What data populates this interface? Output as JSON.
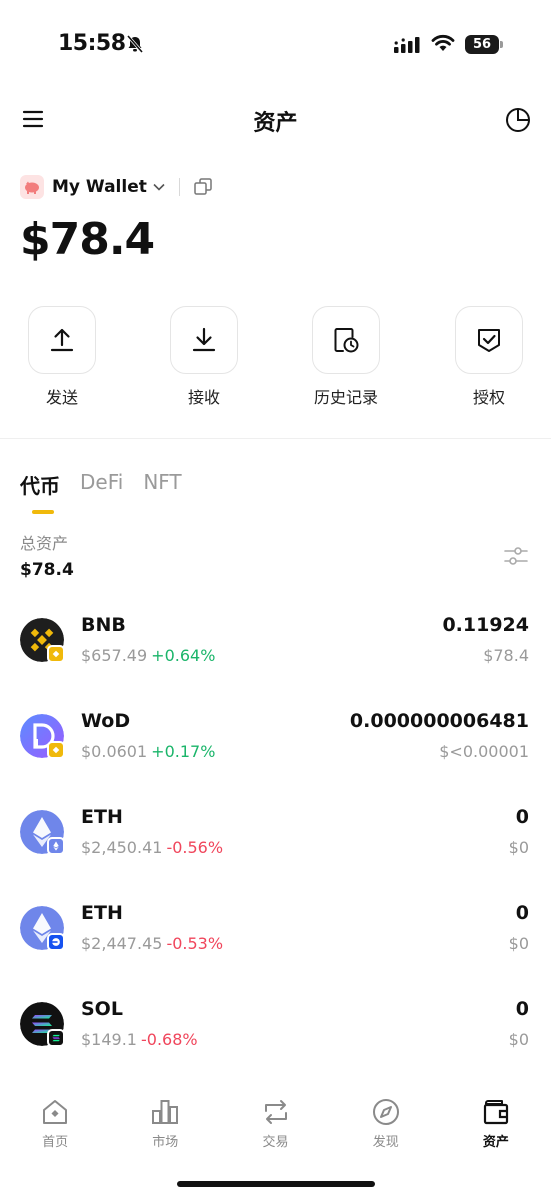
{
  "status_bar": {
    "time": "15:58",
    "battery": "56"
  },
  "header": {
    "title": "资产"
  },
  "wallet": {
    "name": "My Wallet",
    "balance": "$78.4"
  },
  "actions": [
    {
      "label": "发送",
      "icon": "upload-icon"
    },
    {
      "label": "接收",
      "icon": "download-icon"
    },
    {
      "label": "历史记录",
      "icon": "history-icon"
    },
    {
      "label": "授权",
      "icon": "authorize-icon"
    }
  ],
  "tabs": [
    {
      "label": "代币",
      "active": true
    },
    {
      "label": "DeFi",
      "active": false
    },
    {
      "label": "NFT",
      "active": false
    }
  ],
  "summary": {
    "label": "总资产",
    "value": "$78.4"
  },
  "tokens": [
    {
      "symbol": "BNB",
      "price": "$657.49",
      "change": "+0.64%",
      "amount": "0.11924",
      "value": "$78.4",
      "trend": "up"
    },
    {
      "symbol": "WoD",
      "price": "$0.0601",
      "change": "+0.17%",
      "amount": "0.000000006481",
      "value": "$<0.00001",
      "trend": "up"
    },
    {
      "symbol": "ETH",
      "price": "$2,450.41",
      "change": "-0.56%",
      "amount": "0",
      "value": "$0",
      "trend": "down"
    },
    {
      "symbol": "ETH",
      "price": "$2,447.45",
      "change": "-0.53%",
      "amount": "0",
      "value": "$0",
      "trend": "down"
    },
    {
      "symbol": "SOL",
      "price": "$149.1",
      "change": "-0.68%",
      "amount": "0",
      "value": "$0",
      "trend": "down"
    }
  ],
  "nav": [
    {
      "label": "首页",
      "icon": "home-icon",
      "active": false
    },
    {
      "label": "市场",
      "icon": "market-icon",
      "active": false
    },
    {
      "label": "交易",
      "icon": "trade-icon",
      "active": false
    },
    {
      "label": "发现",
      "icon": "discover-icon",
      "active": false
    },
    {
      "label": "资产",
      "icon": "wallet-icon",
      "active": true
    }
  ],
  "colors": {
    "up": "#1bb56a",
    "down": "#f0465c",
    "accent": "#f0b90b",
    "text": "#111111",
    "muted": "#9a9a9a"
  }
}
